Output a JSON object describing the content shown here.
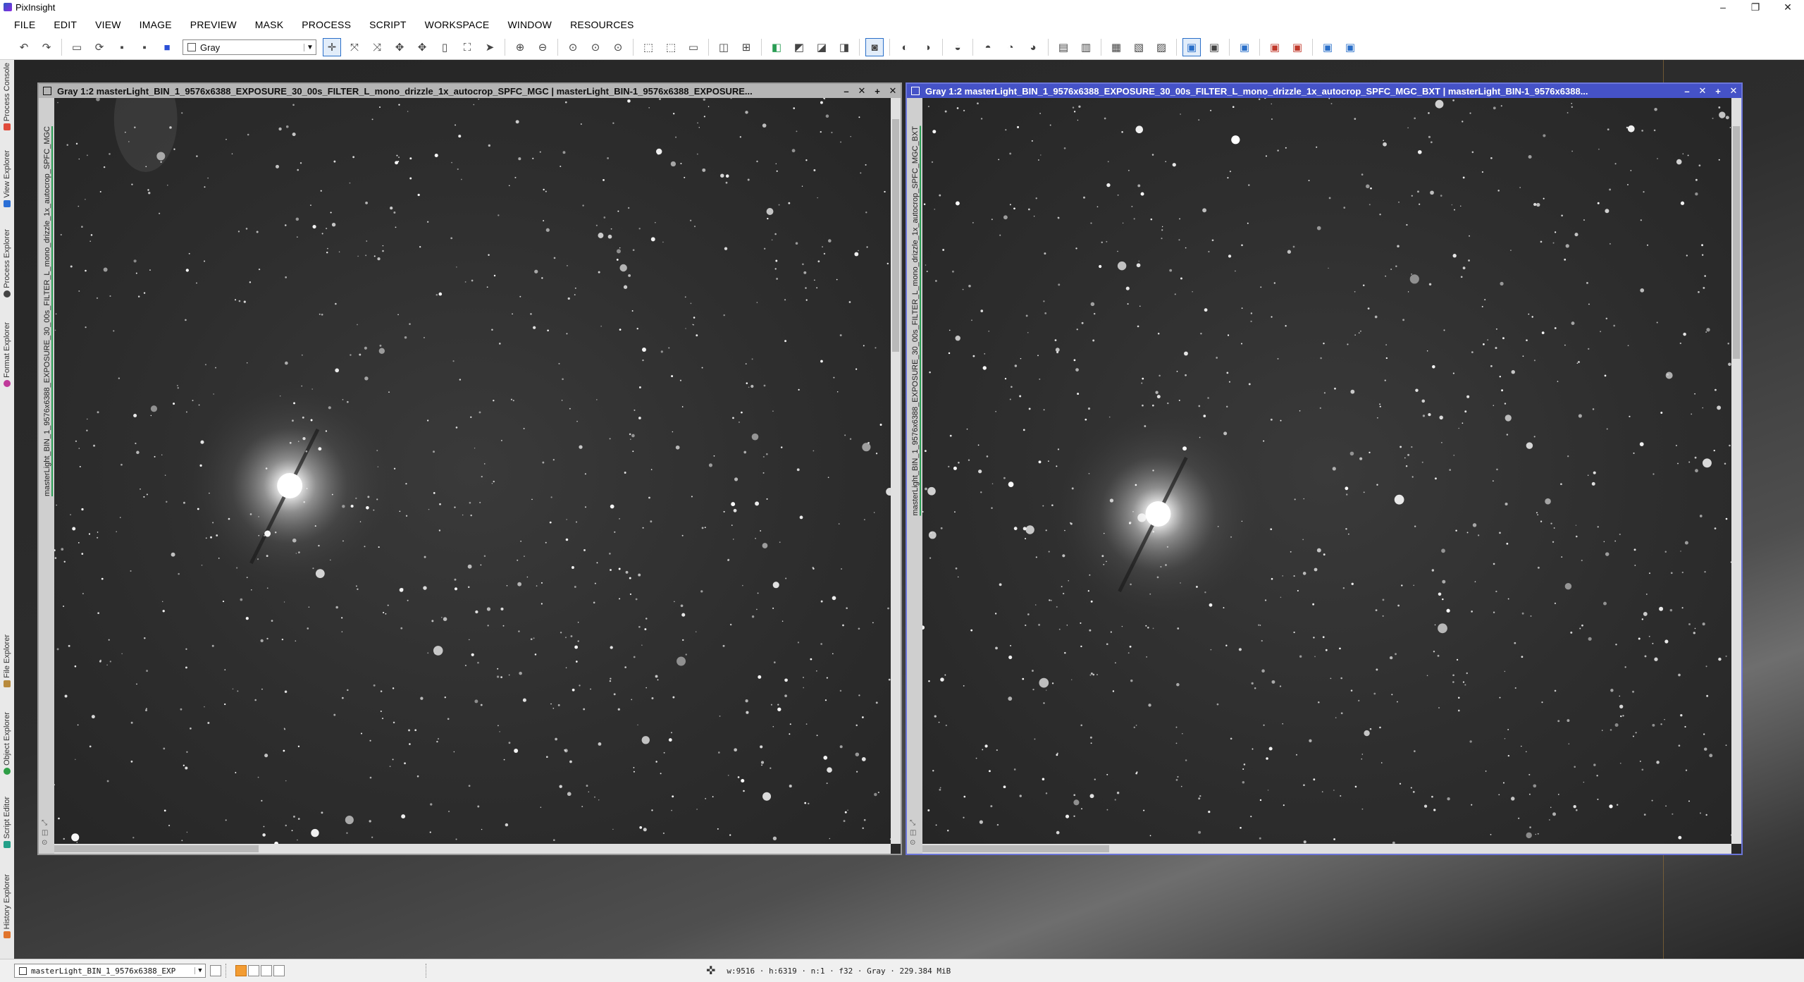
{
  "app": {
    "title": "PixInsight",
    "window_controls": [
      "–",
      "❐",
      "✕"
    ]
  },
  "menu": [
    "FILE",
    "EDIT",
    "VIEW",
    "IMAGE",
    "PREVIEW",
    "MASK",
    "PROCESS",
    "SCRIPT",
    "WORKSPACE",
    "WINDOW",
    "RESOURCES"
  ],
  "toolbar": {
    "color_mode": "Gray"
  },
  "dock_tabs": [
    {
      "label": "Process Console",
      "icon": "console-icon",
      "color": "#e04b3a"
    },
    {
      "label": "View Explorer",
      "icon": "view-explorer-icon",
      "color": "#2b6fd6"
    },
    {
      "label": "Process Explorer",
      "icon": "process-explorer-icon",
      "color": "#444444"
    },
    {
      "label": "Format Explorer",
      "icon": "format-explorer-icon",
      "color": "#c0399a"
    },
    {
      "label": "File Explorer",
      "icon": "file-explorer-icon",
      "color": "#b88a3c"
    },
    {
      "label": "Object Explorer",
      "icon": "object-explorer-icon",
      "color": "#2e9e46"
    },
    {
      "label": "Script Editor",
      "icon": "script-editor-icon",
      "color": "#23a089"
    },
    {
      "label": "History Explorer",
      "icon": "history-explorer-icon",
      "color": "#e0742c"
    }
  ],
  "windows": {
    "left": {
      "title": "Gray 1:2 masterLight_BIN_1_9576x6388_EXPOSURE_30_00s_FILTER_L_mono_drizzle_1x_autocrop_SPFC_MGC | masterLight_BIN-1_9576x6388_EXPOSURE...",
      "side_label": "masterLight_BIN_1_9576x6388_EXPOSURE_30_00s_FILTER_L_mono_drizzle_1x_autocrop_SPFC_MGC",
      "controls": [
        "–",
        "✕",
        "+",
        "✕"
      ]
    },
    "right": {
      "title": "Gray 1:2 masterLight_BIN_1_9576x6388_EXPOSURE_30_00s_FILTER_L_mono_drizzle_1x_autocrop_SPFC_MGC_BXT | masterLight_BIN-1_9576x6388...",
      "side_label": "masterLight_BIN_1_9576x6388_EXPOSURE_30_00s_FILTER_L_mono_drizzle_1x_autocrop_SPFC_MGC_BXT",
      "controls": [
        "–",
        "✕",
        "+",
        "✕"
      ]
    }
  },
  "statusbar": {
    "view_selector": "masterLight_BIN_1_9576x6388_EXP",
    "readout": "w:9516 · h:6319 · n:1 · f32 · Gray · 229.384 MiB"
  }
}
